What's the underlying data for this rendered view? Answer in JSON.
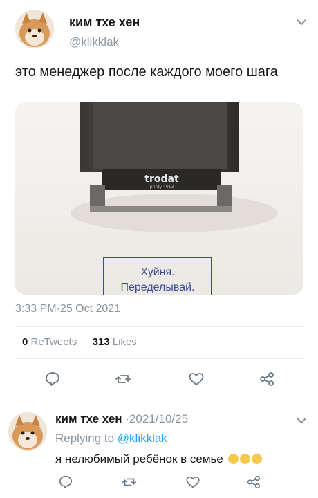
{
  "tweet": {
    "author_name": "ким тхе хен",
    "handle": "@klikklak",
    "text": "это менеджер после каждого моего шага",
    "timestamp": "3:33 PM·25 Oct 2021",
    "image_alt": "trodat printy 4913 stamp",
    "stamp_brand": "trodat",
    "stamp_model": "printy 4913",
    "stamp_line1": "Хуйня.",
    "stamp_line2": "Переделывай.",
    "retweets_count": "0",
    "retweets_label": "ReTweets",
    "likes_count": "313",
    "likes_label": "Likes"
  },
  "reply": {
    "author_name": "ким тхе хен",
    "date": "·2021/10/25",
    "replying_prefix": "Replying to",
    "replying_to": "@klikklak",
    "text": "я нелюбимый ребёнок в семье",
    "emoji_count": 3
  },
  "icons": {
    "reply": "reply-icon",
    "retweet": "retweet-icon",
    "like": "heart-icon",
    "share": "share-icon",
    "more": "chevron-down-icon"
  },
  "colors": {
    "text": "#14171a",
    "muted": "#8a949e",
    "link": "#1da1f2",
    "divider": "#e6ecf0",
    "stamp_ink": "#3a4a9a"
  }
}
